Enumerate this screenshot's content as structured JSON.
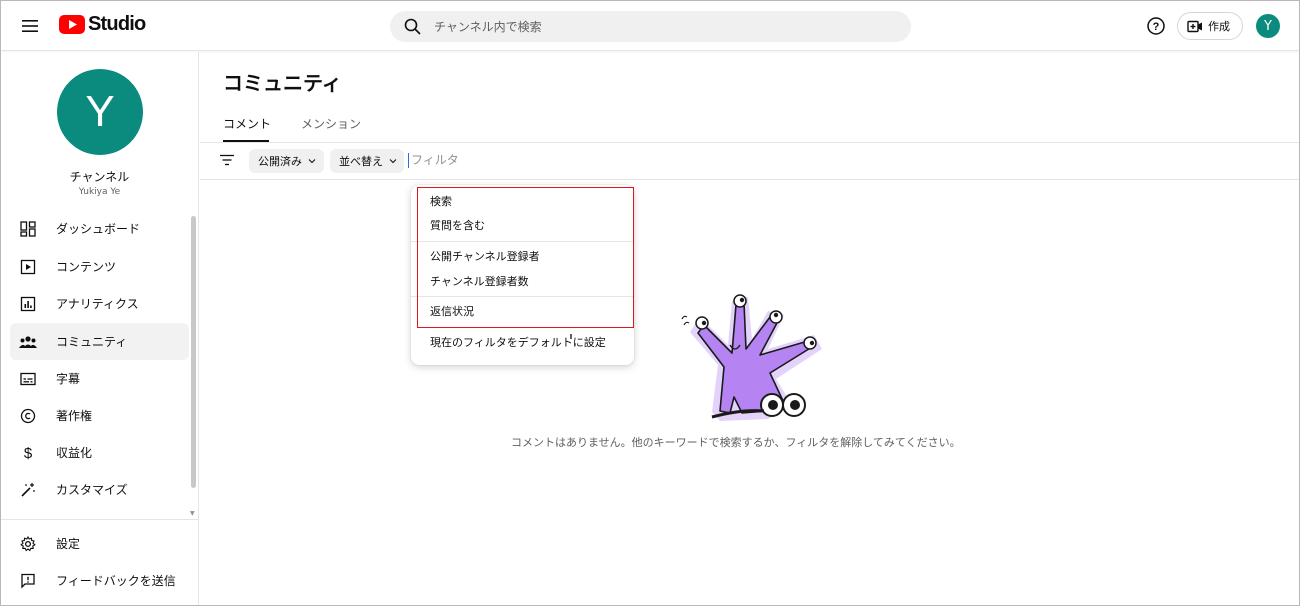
{
  "header": {
    "logo_text": "Studio",
    "search_placeholder": "チャンネル内で検索",
    "create_label": "作成",
    "avatar_letter": "Y"
  },
  "sidebar": {
    "avatar_letter": "Y",
    "channel_title": "チャンネル",
    "channel_name": "Yukiya Ye",
    "items": [
      {
        "label": "ダッシュボード",
        "icon": "dashboard-icon"
      },
      {
        "label": "コンテンツ",
        "icon": "content-icon"
      },
      {
        "label": "アナリティクス",
        "icon": "analytics-icon"
      },
      {
        "label": "コミュニティ",
        "icon": "community-icon",
        "active": true
      },
      {
        "label": "字幕",
        "icon": "subtitles-icon"
      },
      {
        "label": "著作権",
        "icon": "copyright-icon"
      },
      {
        "label": "収益化",
        "icon": "dollar-icon"
      },
      {
        "label": "カスタマイズ",
        "icon": "magic-wand-icon"
      }
    ],
    "bottom_items": [
      {
        "label": "設定",
        "icon": "gear-icon"
      },
      {
        "label": "フィードバックを送信",
        "icon": "feedback-icon"
      }
    ]
  },
  "main": {
    "title": "コミュニティ",
    "tabs": [
      {
        "label": "コメント",
        "active": true
      },
      {
        "label": "メンション",
        "active": false
      }
    ],
    "filters": {
      "chip_published": "公開済み",
      "chip_sort": "並べ替え",
      "filter_placeholder": "フィルタ"
    },
    "dropdown": {
      "group1": [
        "検索",
        "質問を含む"
      ],
      "group2": [
        "公開チャンネル登録者",
        "チャンネル登録者数"
      ],
      "group3": [
        "返信状況"
      ],
      "footer": "現在のフィルタをデフォルトに設定"
    },
    "empty_message": "コメントはありません。他のキーワードで検索するか、フィルタを解除してみてください。"
  },
  "colors": {
    "brand_red": "#ff0000",
    "avatar": "#0b8b7d",
    "highlight": "#e0161f",
    "illustration_purple": "#b583f2"
  }
}
